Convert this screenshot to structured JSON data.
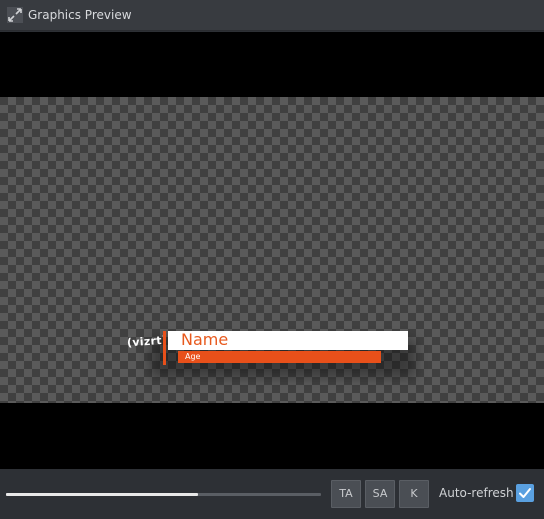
{
  "window": {
    "title": "Graphics Preview",
    "icon": "expand-arrows-icon"
  },
  "preview": {
    "logo_text": "(vizrt)",
    "name_text": "Name",
    "age_text": "Age",
    "colors": {
      "accent": "#e8501a",
      "name_text": "#e85a1e",
      "name_background": "#ffffff"
    }
  },
  "controls": {
    "slider_value_fraction": 0.61,
    "buttons": [
      {
        "label": "TA"
      },
      {
        "label": "SA"
      },
      {
        "label": "K"
      }
    ],
    "auto_refresh_label": "Auto-refresh :",
    "auto_refresh_checked": true,
    "checkbox_color": "#5aa0e0"
  }
}
